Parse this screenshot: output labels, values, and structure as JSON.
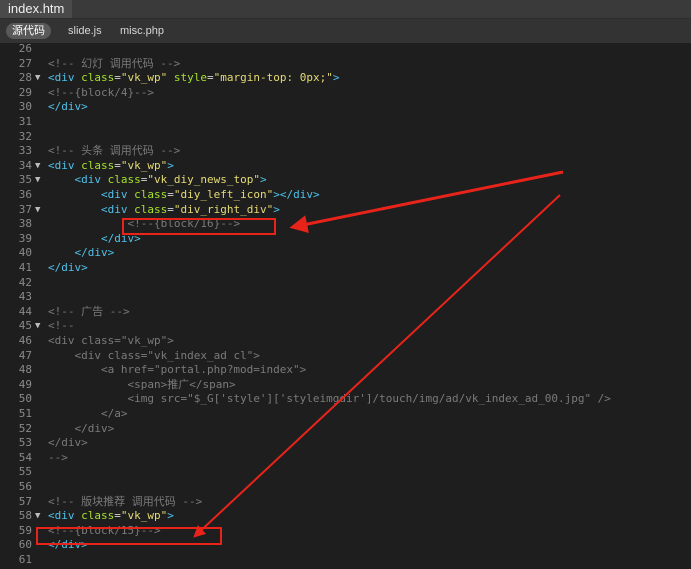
{
  "window": {
    "file_tab": "index.htm"
  },
  "related_files": [
    {
      "label": "源代码",
      "active": true
    },
    {
      "label": "slide.js",
      "active": false
    },
    {
      "label": "misc.php",
      "active": false
    }
  ],
  "colors": {
    "tag": "#4fc1e9",
    "attribute": "#a6e22e",
    "string": "#e6db74",
    "comment": "#7a7a7a",
    "highlight": "#e8241a"
  },
  "lines": [
    {
      "num": "26",
      "fold": "",
      "indent": "",
      "parts": []
    },
    {
      "num": "27",
      "fold": "",
      "indent": "",
      "parts": [
        {
          "t": "com",
          "v": "<!-- 幻灯 调用代码 -->"
        }
      ]
    },
    {
      "num": "28",
      "fold": "▼",
      "indent": "",
      "parts": [
        {
          "t": "tag",
          "v": "<div "
        },
        {
          "t": "attr",
          "v": "class"
        },
        {
          "t": "txt",
          "v": "="
        },
        {
          "t": "str",
          "v": "\"vk_wp\""
        },
        {
          "t": "txt",
          "v": " "
        },
        {
          "t": "attr",
          "v": "style"
        },
        {
          "t": "txt",
          "v": "="
        },
        {
          "t": "str",
          "v": "\"margin-top: 0px;\""
        },
        {
          "t": "tag",
          "v": ">"
        }
      ]
    },
    {
      "num": "29",
      "fold": "",
      "indent": "",
      "parts": [
        {
          "t": "com",
          "v": "<!--{block/4}-->"
        }
      ]
    },
    {
      "num": "30",
      "fold": "",
      "indent": "",
      "parts": [
        {
          "t": "tag",
          "v": "</div>"
        }
      ]
    },
    {
      "num": "31",
      "fold": "",
      "indent": "",
      "parts": []
    },
    {
      "num": "32",
      "fold": "",
      "indent": "",
      "parts": []
    },
    {
      "num": "33",
      "fold": "",
      "indent": "",
      "parts": [
        {
          "t": "com",
          "v": "<!-- 头条 调用代码 -->"
        }
      ]
    },
    {
      "num": "34",
      "fold": "▼",
      "indent": "",
      "parts": [
        {
          "t": "tag",
          "v": "<div "
        },
        {
          "t": "attr",
          "v": "class"
        },
        {
          "t": "txt",
          "v": "="
        },
        {
          "t": "str",
          "v": "\"vk_wp\""
        },
        {
          "t": "tag",
          "v": ">"
        }
      ]
    },
    {
      "num": "35",
      "fold": "▼",
      "indent": "    ",
      "parts": [
        {
          "t": "tag",
          "v": "<div "
        },
        {
          "t": "attr",
          "v": "class"
        },
        {
          "t": "txt",
          "v": "="
        },
        {
          "t": "str",
          "v": "\"vk_diy_news_top\""
        },
        {
          "t": "tag",
          "v": ">"
        }
      ]
    },
    {
      "num": "36",
      "fold": "",
      "indent": "        ",
      "parts": [
        {
          "t": "tag",
          "v": "<div "
        },
        {
          "t": "attr",
          "v": "class"
        },
        {
          "t": "txt",
          "v": "="
        },
        {
          "t": "str",
          "v": "\"diy_left_icon\""
        },
        {
          "t": "tag",
          "v": "></div>"
        }
      ]
    },
    {
      "num": "37",
      "fold": "▼",
      "indent": "        ",
      "parts": [
        {
          "t": "tag",
          "v": "<div "
        },
        {
          "t": "attr",
          "v": "class"
        },
        {
          "t": "txt",
          "v": "="
        },
        {
          "t": "str",
          "v": "\"div_right_div\""
        },
        {
          "t": "tag",
          "v": ">"
        }
      ]
    },
    {
      "num": "38",
      "fold": "",
      "indent": "            ",
      "parts": [
        {
          "t": "com",
          "v": "<!--{block/16}-->"
        }
      ]
    },
    {
      "num": "39",
      "fold": "",
      "indent": "        ",
      "parts": [
        {
          "t": "tag",
          "v": "</div>"
        }
      ]
    },
    {
      "num": "40",
      "fold": "",
      "indent": "    ",
      "parts": [
        {
          "t": "tag",
          "v": "</div>"
        }
      ]
    },
    {
      "num": "41",
      "fold": "",
      "indent": "",
      "parts": [
        {
          "t": "tag",
          "v": "</div>"
        }
      ]
    },
    {
      "num": "42",
      "fold": "",
      "indent": "",
      "parts": []
    },
    {
      "num": "43",
      "fold": "",
      "indent": "",
      "parts": []
    },
    {
      "num": "44",
      "fold": "",
      "indent": "",
      "parts": [
        {
          "t": "com",
          "v": "<!-- 广告 -->"
        }
      ]
    },
    {
      "num": "45",
      "fold": "▼",
      "indent": "",
      "parts": [
        {
          "t": "com",
          "v": "<!--"
        }
      ]
    },
    {
      "num": "46",
      "fold": "",
      "indent": "",
      "parts": [
        {
          "t": "com",
          "v": "<div class=\"vk_wp\">"
        }
      ]
    },
    {
      "num": "47",
      "fold": "",
      "indent": "    ",
      "parts": [
        {
          "t": "com",
          "v": "<div class=\"vk_index_ad cl\">"
        }
      ]
    },
    {
      "num": "48",
      "fold": "",
      "indent": "        ",
      "parts": [
        {
          "t": "com",
          "v": "<a href=\"portal.php?mod=index\">"
        }
      ]
    },
    {
      "num": "49",
      "fold": "",
      "indent": "            ",
      "parts": [
        {
          "t": "com",
          "v": "<span>推广</span>"
        }
      ]
    },
    {
      "num": "50",
      "fold": "",
      "indent": "            ",
      "parts": [
        {
          "t": "com",
          "v": "<img src=\"$_G['style']['styleimgdir']/touch/img/ad/vk_index_ad_00.jpg\" />"
        }
      ]
    },
    {
      "num": "51",
      "fold": "",
      "indent": "        ",
      "parts": [
        {
          "t": "com",
          "v": "</a>"
        }
      ]
    },
    {
      "num": "52",
      "fold": "",
      "indent": "    ",
      "parts": [
        {
          "t": "com",
          "v": "</div>"
        }
      ]
    },
    {
      "num": "53",
      "fold": "",
      "indent": "",
      "parts": [
        {
          "t": "com",
          "v": "</div>"
        }
      ]
    },
    {
      "num": "54",
      "fold": "",
      "indent": "",
      "parts": [
        {
          "t": "com",
          "v": "-->"
        }
      ]
    },
    {
      "num": "55",
      "fold": "",
      "indent": "",
      "parts": []
    },
    {
      "num": "56",
      "fold": "",
      "indent": "",
      "parts": []
    },
    {
      "num": "57",
      "fold": "",
      "indent": "",
      "parts": [
        {
          "t": "com",
          "v": "<!-- 版块推荐 调用代码 -->"
        }
      ]
    },
    {
      "num": "58",
      "fold": "▼",
      "indent": "",
      "parts": [
        {
          "t": "tag",
          "v": "<div "
        },
        {
          "t": "attr",
          "v": "class"
        },
        {
          "t": "txt",
          "v": "="
        },
        {
          "t": "str",
          "v": "\"vk_wp\""
        },
        {
          "t": "tag",
          "v": ">"
        }
      ]
    },
    {
      "num": "59",
      "fold": "",
      "indent": "",
      "parts": [
        {
          "t": "com",
          "v": "<!--{block/15}-->"
        }
      ]
    },
    {
      "num": "60",
      "fold": "",
      "indent": "",
      "parts": [
        {
          "t": "tag",
          "v": "</div>"
        }
      ]
    },
    {
      "num": "61",
      "fold": "",
      "indent": "",
      "parts": []
    }
  ]
}
